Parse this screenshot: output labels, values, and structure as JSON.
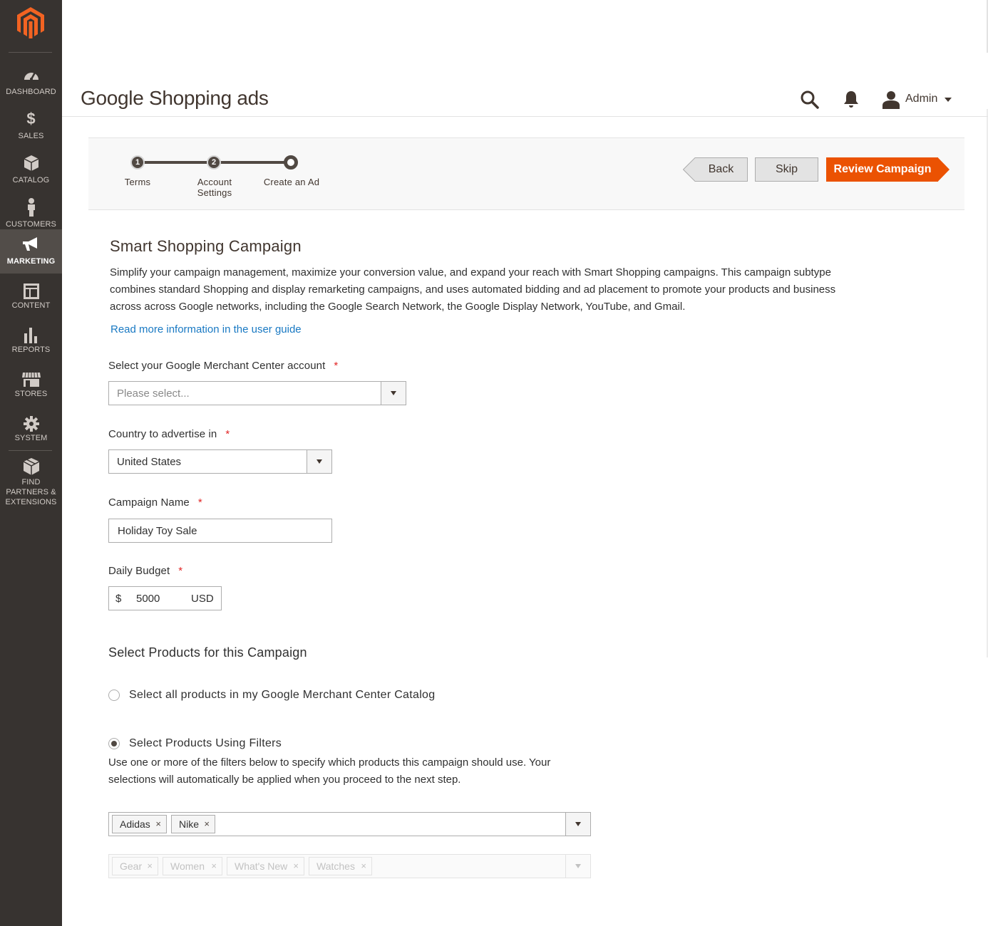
{
  "sidebar": {
    "items": [
      {
        "label": "DASHBOARD",
        "icon": "dashboard-icon"
      },
      {
        "label": "SALES",
        "icon": "dollar-icon"
      },
      {
        "label": "CATALOG",
        "icon": "catalog-box-icon"
      },
      {
        "label": "CUSTOMERS",
        "icon": "customer-person-icon"
      },
      {
        "label": "MARKETING",
        "icon": "megaphone-icon",
        "active": true
      },
      {
        "label": "CONTENT",
        "icon": "content-layout-icon"
      },
      {
        "label": "REPORTS",
        "icon": "bar-chart-icon"
      },
      {
        "label": "STORES",
        "icon": "storefront-icon"
      },
      {
        "label": "SYSTEM",
        "icon": "gear-icon"
      },
      {
        "label": "FIND PARTNERS & EXTENSIONS",
        "icon": "extensions-box-icon"
      }
    ]
  },
  "header": {
    "title": "Google Shopping ads",
    "user": "Admin"
  },
  "wizard": {
    "steps": [
      {
        "number": "1",
        "label": "Terms"
      },
      {
        "number": "2",
        "label": "Account Settings"
      },
      {
        "number": "",
        "label": "Create an Ad"
      }
    ],
    "back_label": "Back",
    "skip_label": "Skip",
    "review_label": "Review Campaign"
  },
  "campaign": {
    "title": "Smart Shopping Campaign",
    "description": "Simplify your campaign management, maximize your conversion value, and expand your reach with Smart Shopping campaigns. This campaign subtype combines standard Shopping and display remarketing campaigns, and uses automated bidding and ad placement to promote your products and business across across Google networks, including the Google Search Network, the Google Display Network, YouTube, and Gmail.",
    "guide_link": "Read more information in the user guide"
  },
  "form": {
    "merchant_label": "Select your Google Merchant Center account",
    "merchant_placeholder": "Please select...",
    "country_label": "Country to advertise in",
    "country_value": "United States",
    "name_label": "Campaign Name",
    "name_value": "Holiday Toy Sale",
    "budget_label": "Daily Budget",
    "budget_currency_symbol": "$",
    "budget_value": "5000",
    "budget_currency": "USD",
    "required_mark": "*"
  },
  "products": {
    "title": "Select Products for this Campaign",
    "option_all": "Select all products in my Google Merchant Center Catalog",
    "option_filters": "Select Products Using Filters",
    "selected_option": "filters",
    "filter_description": "Use one or more of the filters below to specify which products this campaign should use. Your selections will automatically be applied when you proceed to the next step.",
    "brand_tags": [
      "Adidas",
      "Nike"
    ],
    "category_tags": [
      "Gear",
      "Women",
      "What's New",
      "Watches"
    ],
    "tag_remove": "×"
  },
  "colors": {
    "sidebar_bg": "#373330",
    "accent": "#eb5202",
    "link": "#1979c3",
    "required": "#e22626"
  }
}
